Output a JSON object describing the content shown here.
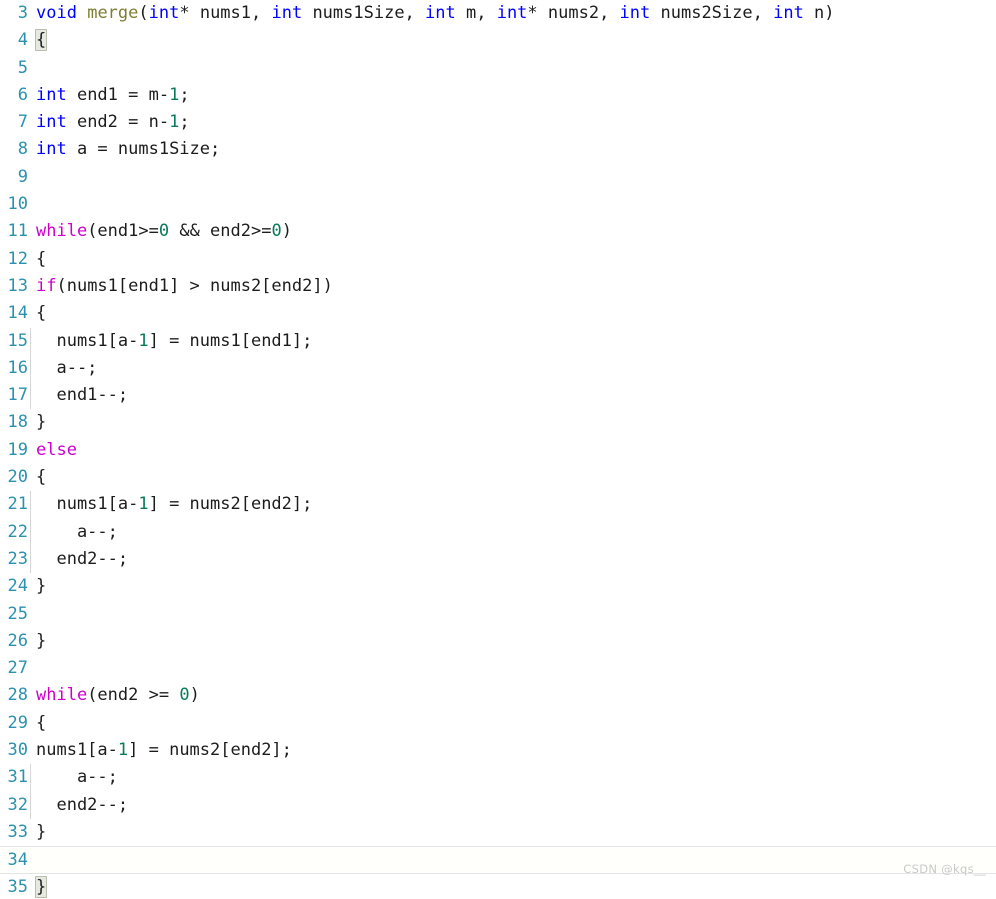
{
  "editor": {
    "language": "C",
    "font_size_px": 17,
    "colors": {
      "background": "#ffffff",
      "line_number": "#2b91af",
      "keyword_type": "#0000ff",
      "keyword_control": "#cc00cc",
      "function_name": "#7d7d33",
      "number_literal": "#097a5b",
      "plain_text": "#1c1c1c",
      "indent_guide": "#d6d6d6",
      "brace_match_highlight": "#e6e9e0",
      "active_line_border": "#e4e4e4",
      "watermark": "#c9c9c9"
    },
    "active_line_number": "34",
    "watermark": "CSDN @kqs__"
  },
  "lines": [
    {
      "number": "3",
      "indent": 0,
      "tokens": [
        {
          "t": "void",
          "c": "kw-type"
        },
        {
          "t": " ",
          "c": "plain"
        },
        {
          "t": "merge",
          "c": "fn"
        },
        {
          "t": "(",
          "c": "punct"
        },
        {
          "t": "int",
          "c": "kw-type"
        },
        {
          "t": "* nums1, ",
          "c": "plain"
        },
        {
          "t": "int",
          "c": "kw-type"
        },
        {
          "t": " nums1Size, ",
          "c": "plain"
        },
        {
          "t": "int",
          "c": "kw-type"
        },
        {
          "t": " m, ",
          "c": "plain"
        },
        {
          "t": "int",
          "c": "kw-type"
        },
        {
          "t": "* nums2, ",
          "c": "plain"
        },
        {
          "t": "int",
          "c": "kw-type"
        },
        {
          "t": " nums2Size, ",
          "c": "plain"
        },
        {
          "t": "int",
          "c": "kw-type"
        },
        {
          "t": " n)",
          "c": "plain"
        }
      ]
    },
    {
      "number": "4",
      "indent": 0,
      "tokens": [
        {
          "t": "{",
          "c": "plain",
          "hl": true
        }
      ]
    },
    {
      "number": "5",
      "indent": 0,
      "tokens": []
    },
    {
      "number": "6",
      "indent": 0,
      "tokens": [
        {
          "t": "int",
          "c": "kw-type"
        },
        {
          "t": " end1 = m-",
          "c": "plain"
        },
        {
          "t": "1",
          "c": "num-lit"
        },
        {
          "t": ";",
          "c": "plain"
        }
      ]
    },
    {
      "number": "7",
      "indent": 0,
      "tokens": [
        {
          "t": "int",
          "c": "kw-type"
        },
        {
          "t": " end2 = n-",
          "c": "plain"
        },
        {
          "t": "1",
          "c": "num-lit"
        },
        {
          "t": ";",
          "c": "plain"
        }
      ]
    },
    {
      "number": "8",
      "indent": 0,
      "tokens": [
        {
          "t": "int",
          "c": "kw-type"
        },
        {
          "t": " a = nums1Size;",
          "c": "plain"
        }
      ]
    },
    {
      "number": "9",
      "indent": 0,
      "tokens": []
    },
    {
      "number": "10",
      "indent": 0,
      "tokens": []
    },
    {
      "number": "11",
      "indent": 0,
      "tokens": [
        {
          "t": "while",
          "c": "kw-ctrl"
        },
        {
          "t": "(end1>=",
          "c": "plain"
        },
        {
          "t": "0",
          "c": "num-lit"
        },
        {
          "t": " && end2>=",
          "c": "plain"
        },
        {
          "t": "0",
          "c": "num-lit"
        },
        {
          "t": ")",
          "c": "plain"
        }
      ]
    },
    {
      "number": "12",
      "indent": 0,
      "tokens": [
        {
          "t": "{",
          "c": "plain"
        }
      ]
    },
    {
      "number": "13",
      "indent": 0,
      "tokens": [
        {
          "t": "if",
          "c": "kw-ctrl"
        },
        {
          "t": "(nums1[end1] > nums2[end2])",
          "c": "plain"
        }
      ]
    },
    {
      "number": "14",
      "indent": 0,
      "tokens": [
        {
          "t": "{",
          "c": "plain"
        }
      ]
    },
    {
      "number": "15",
      "indent": 1,
      "tokens": [
        {
          "t": "  nums1[a-",
          "c": "plain"
        },
        {
          "t": "1",
          "c": "num-lit"
        },
        {
          "t": "] = nums1[end1];",
          "c": "plain"
        }
      ]
    },
    {
      "number": "16",
      "indent": 1,
      "tokens": [
        {
          "t": "  a--;",
          "c": "plain"
        }
      ]
    },
    {
      "number": "17",
      "indent": 1,
      "tokens": [
        {
          "t": "  end1--;",
          "c": "plain"
        }
      ]
    },
    {
      "number": "18",
      "indent": 0,
      "tokens": [
        {
          "t": "}",
          "c": "plain"
        }
      ]
    },
    {
      "number": "19",
      "indent": 0,
      "tokens": [
        {
          "t": "else",
          "c": "kw-ctrl"
        }
      ]
    },
    {
      "number": "20",
      "indent": 0,
      "tokens": [
        {
          "t": "{",
          "c": "plain"
        }
      ]
    },
    {
      "number": "21",
      "indent": 1,
      "tokens": [
        {
          "t": "  nums1[a-",
          "c": "plain"
        },
        {
          "t": "1",
          "c": "num-lit"
        },
        {
          "t": "] = nums2[end2];",
          "c": "plain"
        }
      ]
    },
    {
      "number": "22",
      "indent": 1,
      "tokens": [
        {
          "t": "    a--;",
          "c": "plain"
        }
      ]
    },
    {
      "number": "23",
      "indent": 1,
      "tokens": [
        {
          "t": "  end2--;",
          "c": "plain"
        }
      ]
    },
    {
      "number": "24",
      "indent": 0,
      "tokens": [
        {
          "t": "}",
          "c": "plain"
        }
      ]
    },
    {
      "number": "25",
      "indent": 0,
      "tokens": []
    },
    {
      "number": "26",
      "indent": 0,
      "tokens": [
        {
          "t": "}",
          "c": "plain"
        }
      ]
    },
    {
      "number": "27",
      "indent": 0,
      "tokens": []
    },
    {
      "number": "28",
      "indent": 0,
      "tokens": [
        {
          "t": "while",
          "c": "kw-ctrl"
        },
        {
          "t": "(end2 >= ",
          "c": "plain"
        },
        {
          "t": "0",
          "c": "num-lit"
        },
        {
          "t": ")",
          "c": "plain"
        }
      ]
    },
    {
      "number": "29",
      "indent": 0,
      "tokens": [
        {
          "t": "{",
          "c": "plain"
        }
      ]
    },
    {
      "number": "30",
      "indent": 0,
      "tokens": [
        {
          "t": "nums1[a-",
          "c": "plain"
        },
        {
          "t": "1",
          "c": "num-lit"
        },
        {
          "t": "] = nums2[end2];",
          "c": "plain"
        }
      ]
    },
    {
      "number": "31",
      "indent": 1,
      "tokens": [
        {
          "t": "    a--;",
          "c": "plain"
        }
      ]
    },
    {
      "number": "32",
      "indent": 1,
      "tokens": [
        {
          "t": "  end2--;",
          "c": "plain"
        }
      ]
    },
    {
      "number": "33",
      "indent": 0,
      "tokens": [
        {
          "t": "}",
          "c": "plain"
        }
      ]
    },
    {
      "number": "34",
      "indent": 0,
      "active": true,
      "tokens": []
    },
    {
      "number": "35",
      "indent": 0,
      "tokens": [
        {
          "t": "}",
          "c": "plain",
          "hl": true
        }
      ]
    }
  ]
}
